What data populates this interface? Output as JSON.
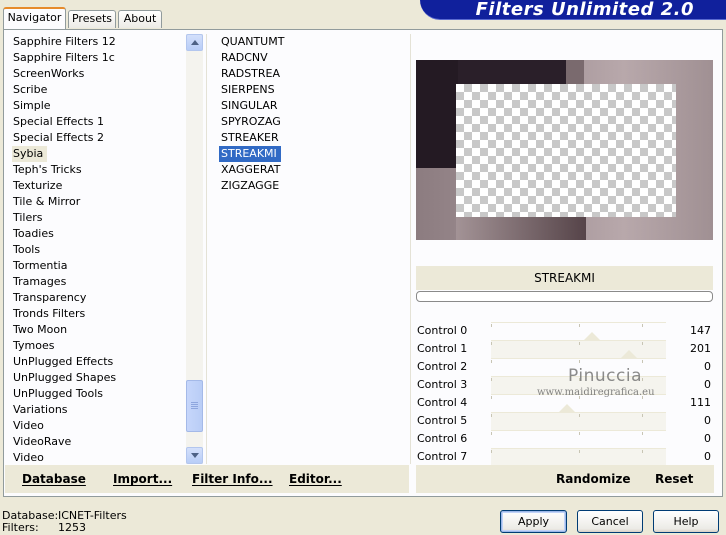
{
  "tabs": [
    {
      "label": "Navigator",
      "active": true
    },
    {
      "label": "Presets",
      "active": false
    },
    {
      "label": "About",
      "active": false
    }
  ],
  "banner_title": "Filters Unlimited 2.0",
  "categories": [
    "Sapphire Filters 12",
    "Sapphire Filters 1c",
    "ScreenWorks",
    "Scribe",
    "Simple",
    "Special Effects 1",
    "Special Effects 2",
    "Sybia",
    "Teph's Tricks",
    "Texturize",
    "Tile & Mirror",
    "Tilers",
    "Toadies",
    "Tools",
    "Tormentia",
    "Tramages",
    "Transparency",
    "Tronds Filters",
    "Two Moon",
    "Tymoes",
    "UnPlugged Effects",
    "UnPlugged Shapes",
    "UnPlugged Tools",
    "Variations",
    "Video",
    "VideoRave",
    "Video"
  ],
  "selected_category": "Sybia",
  "filters": [
    "QUANTUMT",
    "RADCNV",
    "RADSTREA",
    "SIERPENS",
    "SINGULAR",
    "SPYROZAG",
    "STREAKER",
    "STREAKMI",
    "XAGGERAT",
    "ZIGZAGGE"
  ],
  "selected_filter": "STREAKMI",
  "left_actions": {
    "database": "Database",
    "import": "Import...",
    "filter_info": "Filter Info...",
    "editor": "Editor..."
  },
  "filter_name": "STREAKMI",
  "controls": [
    {
      "label": "Control 0",
      "value": "147",
      "level": 0.576
    },
    {
      "label": "Control 1",
      "value": "201",
      "level": 0.788
    },
    {
      "label": "Control 2",
      "value": "0",
      "level": 0
    },
    {
      "label": "Control 3",
      "value": "0",
      "level": 0
    },
    {
      "label": "Control 4",
      "value": "111",
      "level": 0.435
    },
    {
      "label": "Control 5",
      "value": "0",
      "level": 0
    },
    {
      "label": "Control 6",
      "value": "0",
      "level": 0
    },
    {
      "label": "Control 7",
      "value": "0",
      "level": 0
    }
  ],
  "right_actions": {
    "randomize": "Randomize",
    "reset": "Reset"
  },
  "watermark": {
    "title": "Pinuccia",
    "url": "www.maidiregrafica.eu"
  },
  "status": {
    "database_label": "Database:",
    "database_value": "ICNET-Filters",
    "filters_label": "Filters:",
    "filters_value": "1253"
  },
  "buttons": {
    "apply": "Apply",
    "cancel": "Cancel",
    "help": "Help"
  },
  "colors": {
    "selection": "#316ac5",
    "banner": "#10209c",
    "tab_accent": "#e68b2c"
  }
}
